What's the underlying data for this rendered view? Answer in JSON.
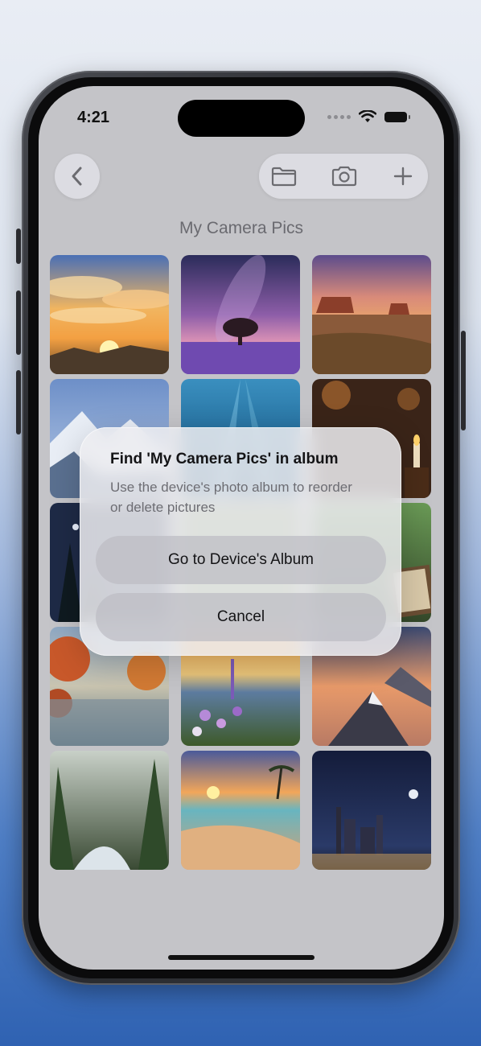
{
  "status_bar": {
    "time": "4:21"
  },
  "navigation": {
    "back_icon": "chevron-left-icon",
    "toolbar_icons": [
      "folder-icon",
      "camera-icon",
      "plus-icon"
    ]
  },
  "page": {
    "title": "My Camera Pics"
  },
  "photos": [
    "sunset-clouds",
    "lavender-tree-milky-way",
    "desert-buttes",
    "snowy-mountains",
    "underwater-rays",
    "candlelit-room",
    "night-forest",
    "",
    "forest-book",
    "autumn-lake",
    "flower-lake-sunset",
    "mountain-sea-of-clouds",
    "forest-stream",
    "tropical-beach-sunset",
    "city-night-skyline"
  ],
  "dialog": {
    "title": "Find 'My Camera Pics' in album",
    "message": "Use the device's photo album to reorder or delete pictures",
    "primary_button": "Go to Device's Album",
    "cancel_button": "Cancel"
  },
  "colors": {
    "screen_bg": "#c4c4c8",
    "dialog_bg": "#ececf0",
    "button_bg": "#bebec4"
  }
}
